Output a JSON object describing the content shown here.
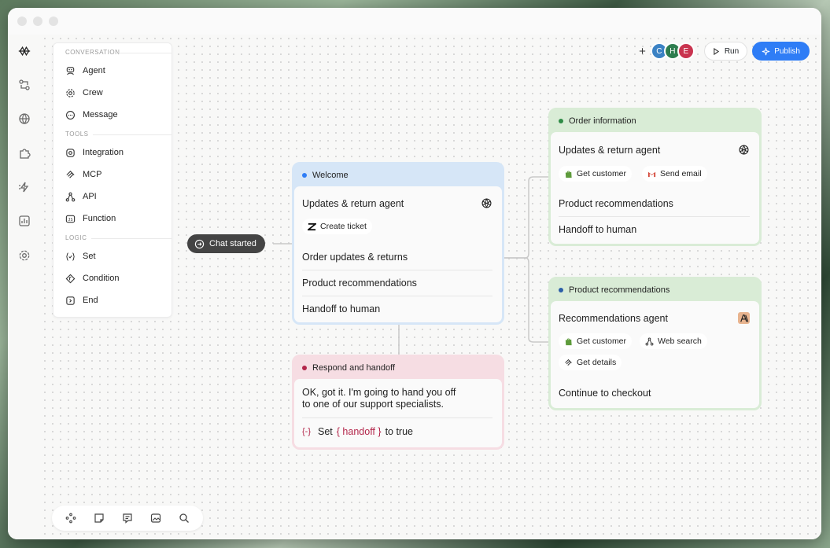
{
  "palette": {
    "sections": [
      "CONVERSATION",
      "TOOLS",
      "LOGIC"
    ],
    "conversation": [
      {
        "label": "Agent",
        "icon": "agent-icon"
      },
      {
        "label": "Crew",
        "icon": "crew-icon"
      },
      {
        "label": "Message",
        "icon": "message-icon"
      }
    ],
    "tools": [
      {
        "label": "Integration",
        "icon": "integration-icon"
      },
      {
        "label": "MCP",
        "icon": "mcp-icon"
      },
      {
        "label": "API",
        "icon": "api-icon"
      },
      {
        "label": "Function",
        "icon": "function-icon"
      }
    ],
    "logic": [
      {
        "label": "Set",
        "icon": "set-icon"
      },
      {
        "label": "Condition",
        "icon": "condition-icon"
      },
      {
        "label": "End",
        "icon": "end-icon"
      }
    ]
  },
  "toolbar": {
    "add": "+",
    "avatars": [
      {
        "initial": "C",
        "color": "#3b82c4"
      },
      {
        "initial": "H",
        "color": "#2e7d4f"
      },
      {
        "initial": "E",
        "color": "#c9344f"
      }
    ],
    "run_label": "Run",
    "publish_label": "Publish"
  },
  "start": {
    "label": "Chat started"
  },
  "welcome": {
    "title": "Welcome",
    "accent": "#2f7df6",
    "agent": "Updates & return agent",
    "tool": "Create ticket",
    "routes": [
      "Order updates & returns",
      "Product recommendations",
      "Handoff to human"
    ]
  },
  "respond": {
    "title": "Respond and handoff",
    "accent": "#b3264a",
    "message_line1": "OK, got it. I'm going to hand you off",
    "message_line2": "to one of our support specialists.",
    "set_prefix": "Set",
    "set_var": "{ handoff }",
    "set_suffix": "to true"
  },
  "order": {
    "title": "Order information",
    "accent": "#2e8b46",
    "agent": "Updates & return agent",
    "tools": [
      "Get customer",
      "Send email"
    ],
    "routes": [
      "Product recommendations",
      "Handoff to human"
    ]
  },
  "product": {
    "title": "Product recommendations",
    "accent": "#2c5fa8",
    "agent": "Recommendations agent",
    "tools": [
      "Get customer",
      "Web search",
      "Get details"
    ],
    "route": "Continue to checkout"
  },
  "bottom_tools": [
    "nodes-icon",
    "note-icon",
    "comment-icon",
    "image-icon",
    "search-icon"
  ]
}
